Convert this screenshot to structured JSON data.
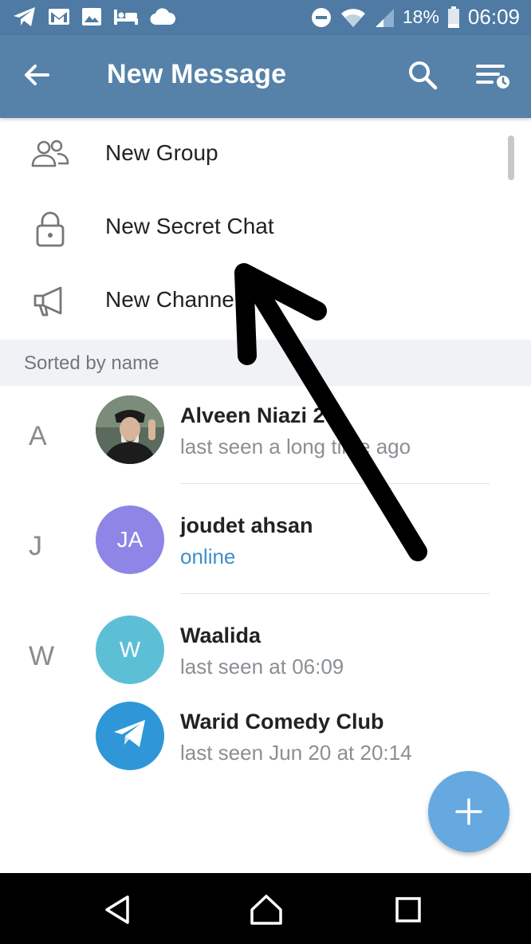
{
  "status_bar": {
    "battery": "18%",
    "time": "06:09",
    "left_icons": [
      "telegram-icon",
      "gmail-icon",
      "gallery-icon",
      "bed-icon",
      "cloud-icon"
    ],
    "right_icons": [
      "dnd-icon",
      "wifi-icon",
      "signal-icon",
      "battery-icon"
    ]
  },
  "app_bar": {
    "title": "New Message",
    "icons": [
      "back-arrow-icon",
      "search-icon",
      "sort-icon"
    ]
  },
  "menu": {
    "items": [
      {
        "label": "New Group",
        "icon": "group-icon"
      },
      {
        "label": "New Secret Chat",
        "icon": "lock-icon"
      },
      {
        "label": "New Channel",
        "icon": "megaphone-icon"
      }
    ]
  },
  "section": {
    "header": "Sorted by name"
  },
  "contacts": [
    {
      "letter": "A",
      "name": "Alveen Niazi 2",
      "status": "last seen a long time ago",
      "avatar_initials": "",
      "avatar_color": "#3a2e26"
    },
    {
      "letter": "J",
      "name": "joudet ahsan",
      "status": "online",
      "avatar_initials": "JA",
      "avatar_color": "#8e85e6"
    },
    {
      "letter": "W",
      "name": "Waalida",
      "status": "last seen at 06:09",
      "avatar_initials": "W",
      "avatar_color": "#5cbfd6"
    },
    {
      "letter": "",
      "name": "Warid Comedy Club",
      "status": "last seen Jun 20 at 20:14",
      "avatar_initials": "",
      "avatar_color": "#2f97d8"
    }
  ],
  "fab": {
    "icon": "plus-icon"
  },
  "nav_bar": {
    "icons": [
      "nav-back-icon",
      "nav-home-icon",
      "nav-recents-icon"
    ]
  },
  "colors": {
    "header": "#5682a9",
    "status_bar": "#4e7aa3",
    "accent_online": "#3d8fcb",
    "fab": "#65a9e0"
  }
}
